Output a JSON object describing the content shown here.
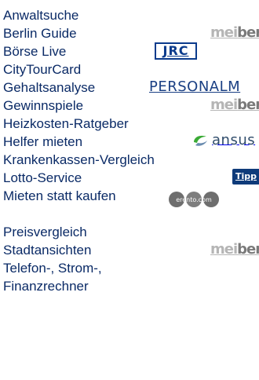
{
  "services": [
    {
      "label": "Anwaltsuche",
      "logo": null
    },
    {
      "label": "Berlin Guide",
      "logo": {
        "kind": "meinberlin",
        "text_a": "mei",
        "text_b": "ber"
      }
    },
    {
      "label": "Börse Live",
      "logo": {
        "kind": "jrc",
        "text": "JRC"
      }
    },
    {
      "label": "CityTourCard",
      "logo": null
    },
    {
      "label": "Gehaltsanalyse",
      "logo": {
        "kind": "personal",
        "text": "PERSONALM"
      }
    },
    {
      "label": "Gewinnspiele",
      "logo": {
        "kind": "meinberlin",
        "text_a": "mei",
        "text_b": "ber"
      }
    },
    {
      "label": "Heizkosten-Ratgeber",
      "logo": null
    },
    {
      "label": "Helfer mieten",
      "logo": {
        "kind": "ansus",
        "text": "ansus"
      }
    },
    {
      "label": "Krankenkassen-Vergleich",
      "logo": null
    },
    {
      "label": "Lotto-Service",
      "logo": {
        "kind": "tipp",
        "text": "Tipp"
      }
    },
    {
      "label": "Mieten statt kaufen",
      "logo": {
        "kind": "rento",
        "text": "erento.com"
      }
    },
    {
      "label": "Preisvergleich",
      "logo": null
    },
    {
      "label": "Stadtansichten",
      "logo": {
        "kind": "meinberlin",
        "text_a": "mei",
        "text_b": "ber"
      }
    },
    {
      "label": "Telefon-, Strom-, Finanzrechner",
      "logo": null
    }
  ],
  "colors": {
    "link": "#0a2a66",
    "jrc_blue": "#0b3b8c",
    "tipp_bg": "#0f3b7a",
    "meinberlin_grey": "#b5b5b5",
    "rento_grey": "#808080",
    "ansus_green": "#3aaa35"
  },
  "icons": {
    "ansus": "ansus-swirl-icon",
    "rento": "erento-circles-icon"
  }
}
